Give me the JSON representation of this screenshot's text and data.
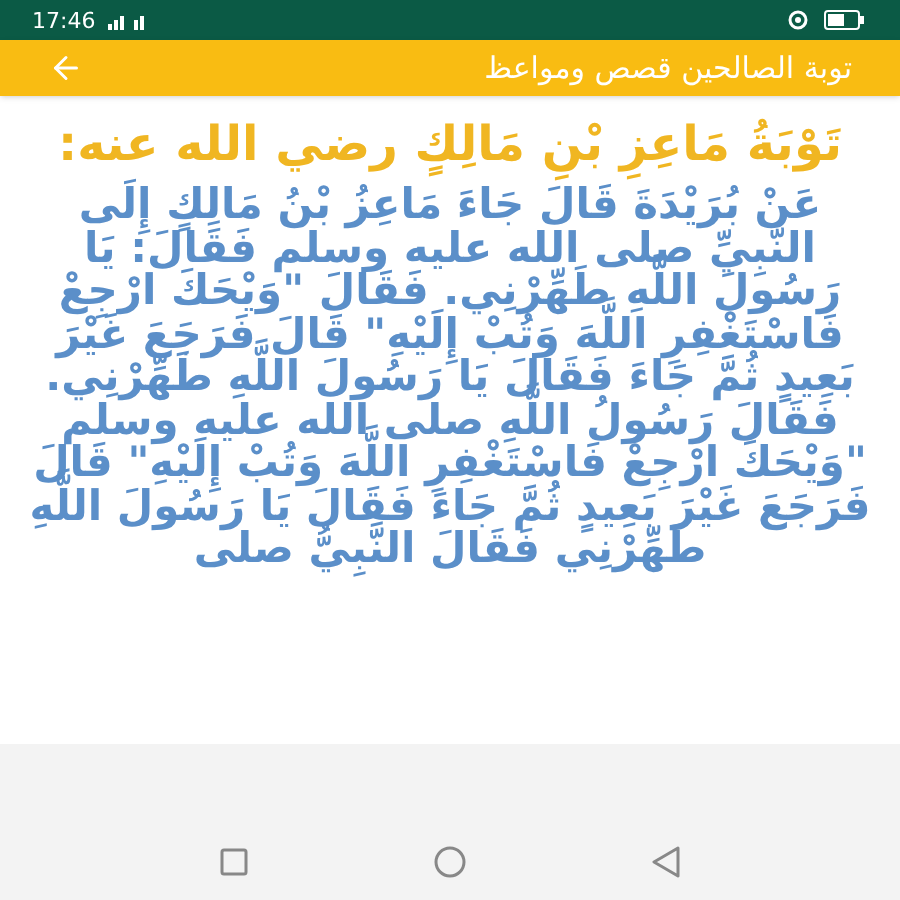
{
  "status_bar": {
    "time": "17:46"
  },
  "app_bar": {
    "title": "توبة الصالحين قصص ومواعظ"
  },
  "story": {
    "heading": "تَوْبَةُ مَاعِزِ بْنِ مَالِكٍ رضي الله عنه:",
    "body": "عَنْ بُرَيْدَةَ قَالَ جَاءَ مَاعِزُ بْنُ مَالِكٍ إِلَى النَّبِيِّ صلى الله عليه وسلم فَقَالَ: يَا رَسُولَ اللَّهِ طَهِّرْنِي. فَقَالَ \"وَيْحَكَ ارْجِعْ فَاسْتَغْفِرِ اللَّهَ وَتُبْ إِلَيْهِ\" قَالَ فَرَجَعَ غَيْرَ بَعِيدٍ ثُمَّ جَاءَ فَقَالَ يَا رَسُولَ اللَّهِ طَهِّرْنِي. فَقَالَ رَسُولُ اللَّهِ صلى الله عليه وسلم \"وَيْحَكَ ارْجِعْ فَاسْتَغْفِرِ اللَّهَ وَتُبْ إِلَيْهِ\" قَالَ فَرَجَعَ غَيْرَ بَعِيدٍ ثُمَّ جَاءَ فَقَالَ يَا رَسُولَ اللَّهِ طَهِّرْنِي فَقَالَ النَّبِيُّ صلى"
  }
}
